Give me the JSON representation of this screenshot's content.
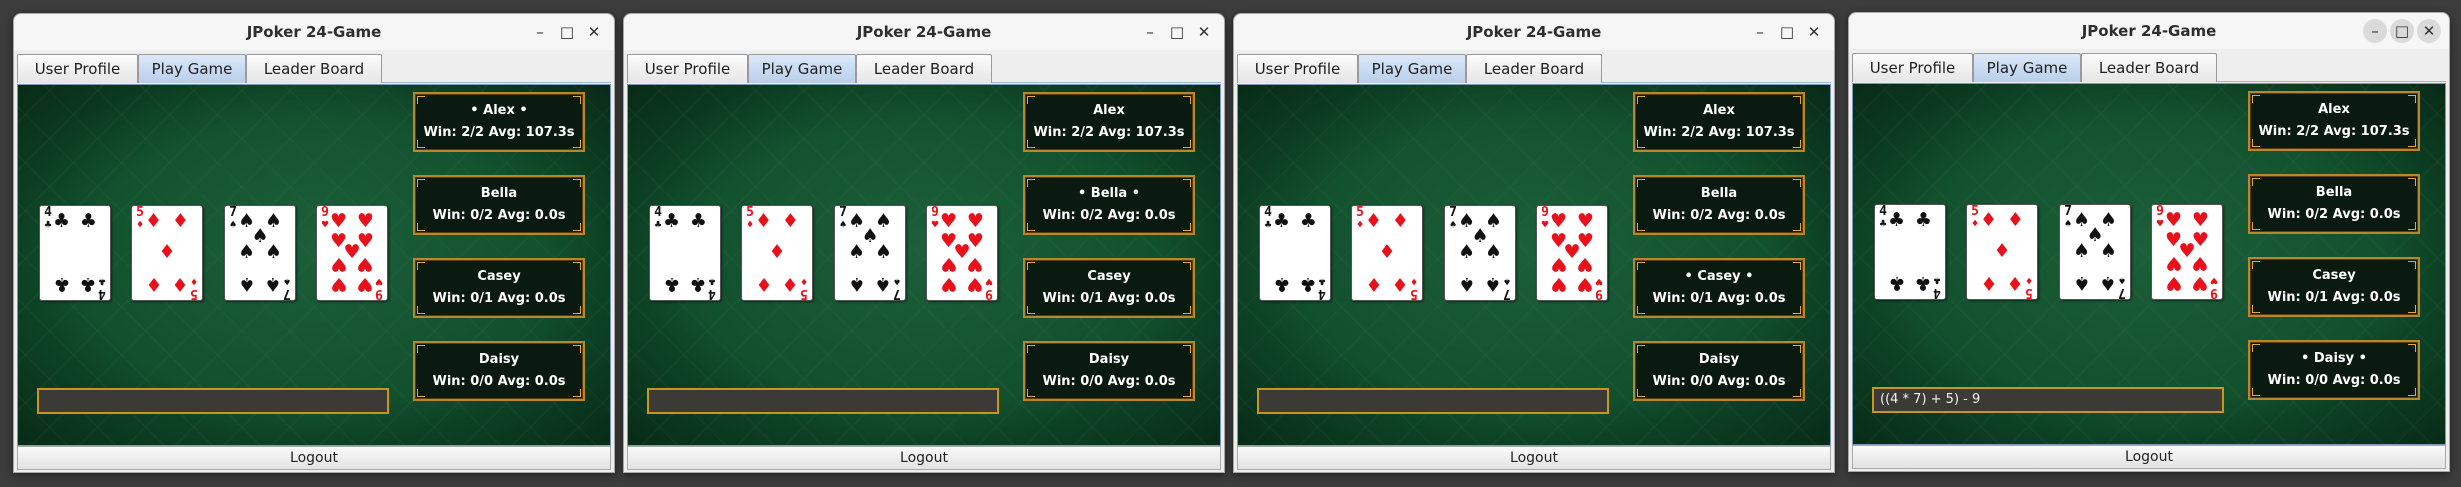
{
  "windows": [
    {
      "title": "JPoker 24-Game",
      "tabs": [
        "User Profile",
        "Play Game",
        "Leader Board"
      ],
      "active_tab": "Play Game",
      "cards": [
        {
          "rank": "4",
          "suit": "♣",
          "color": "black"
        },
        {
          "rank": "5",
          "suit": "♦",
          "color": "red"
        },
        {
          "rank": "7",
          "suit": "♠",
          "color": "black"
        },
        {
          "rank": "9",
          "suit": "♥",
          "color": "red"
        }
      ],
      "players": [
        {
          "name": "• Alex •",
          "stats": "Win: 2/2 Avg: 107.3s"
        },
        {
          "name": "Bella",
          "stats": "Win: 0/2 Avg: 0.0s"
        },
        {
          "name": "Casey",
          "stats": "Win: 0/1 Avg: 0.0s"
        },
        {
          "name": "Daisy",
          "stats": "Win: 0/0 Avg: 0.0s"
        }
      ],
      "expression": "",
      "logout_label": "Logout"
    },
    {
      "title": "JPoker 24-Game",
      "tabs": [
        "User Profile",
        "Play Game",
        "Leader Board"
      ],
      "active_tab": "Play Game",
      "cards": [
        {
          "rank": "4",
          "suit": "♣",
          "color": "black"
        },
        {
          "rank": "5",
          "suit": "♦",
          "color": "red"
        },
        {
          "rank": "7",
          "suit": "♠",
          "color": "black"
        },
        {
          "rank": "9",
          "suit": "♥",
          "color": "red"
        }
      ],
      "players": [
        {
          "name": "Alex",
          "stats": "Win: 2/2 Avg: 107.3s"
        },
        {
          "name": "• Bella •",
          "stats": "Win: 0/2 Avg: 0.0s"
        },
        {
          "name": "Casey",
          "stats": "Win: 0/1 Avg: 0.0s"
        },
        {
          "name": "Daisy",
          "stats": "Win: 0/0 Avg: 0.0s"
        }
      ],
      "expression": "",
      "logout_label": "Logout"
    },
    {
      "title": "JPoker 24-Game",
      "tabs": [
        "User Profile",
        "Play Game",
        "Leader Board"
      ],
      "active_tab": "Play Game",
      "cards": [
        {
          "rank": "4",
          "suit": "♣",
          "color": "black"
        },
        {
          "rank": "5",
          "suit": "♦",
          "color": "red"
        },
        {
          "rank": "7",
          "suit": "♠",
          "color": "black"
        },
        {
          "rank": "9",
          "suit": "♥",
          "color": "red"
        }
      ],
      "players": [
        {
          "name": "Alex",
          "stats": "Win: 2/2 Avg: 107.3s"
        },
        {
          "name": "Bella",
          "stats": "Win: 0/2 Avg: 0.0s"
        },
        {
          "name": "• Casey •",
          "stats": "Win: 0/1 Avg: 0.0s"
        },
        {
          "name": "Daisy",
          "stats": "Win: 0/0 Avg: 0.0s"
        }
      ],
      "expression": "",
      "logout_label": "Logout"
    },
    {
      "title": "JPoker 24-Game",
      "tabs": [
        "User Profile",
        "Play Game",
        "Leader Board"
      ],
      "active_tab": "Play Game",
      "cards": [
        {
          "rank": "4",
          "suit": "♣",
          "color": "black"
        },
        {
          "rank": "5",
          "suit": "♦",
          "color": "red"
        },
        {
          "rank": "7",
          "suit": "♠",
          "color": "black"
        },
        {
          "rank": "9",
          "suit": "♥",
          "color": "red"
        }
      ],
      "players": [
        {
          "name": "Alex",
          "stats": "Win: 2/2 Avg: 107.3s"
        },
        {
          "name": "Bella",
          "stats": "Win: 0/2 Avg: 0.0s"
        },
        {
          "name": "Casey",
          "stats": "Win: 0/1 Avg: 0.0s"
        },
        {
          "name": "• Daisy •",
          "stats": "Win: 0/0 Avg: 0.0s"
        }
      ],
      "expression": "((4 * 7) + 5) - 9",
      "logout_label": "Logout"
    }
  ],
  "window_controls": {
    "minimize": "–",
    "maximize": "□",
    "close": "✕"
  },
  "colors": {
    "felt": "#0f4d2b",
    "panel_border": "#b8862b",
    "red_suit": "#e8101a",
    "active_tab": "#b8cfea"
  }
}
